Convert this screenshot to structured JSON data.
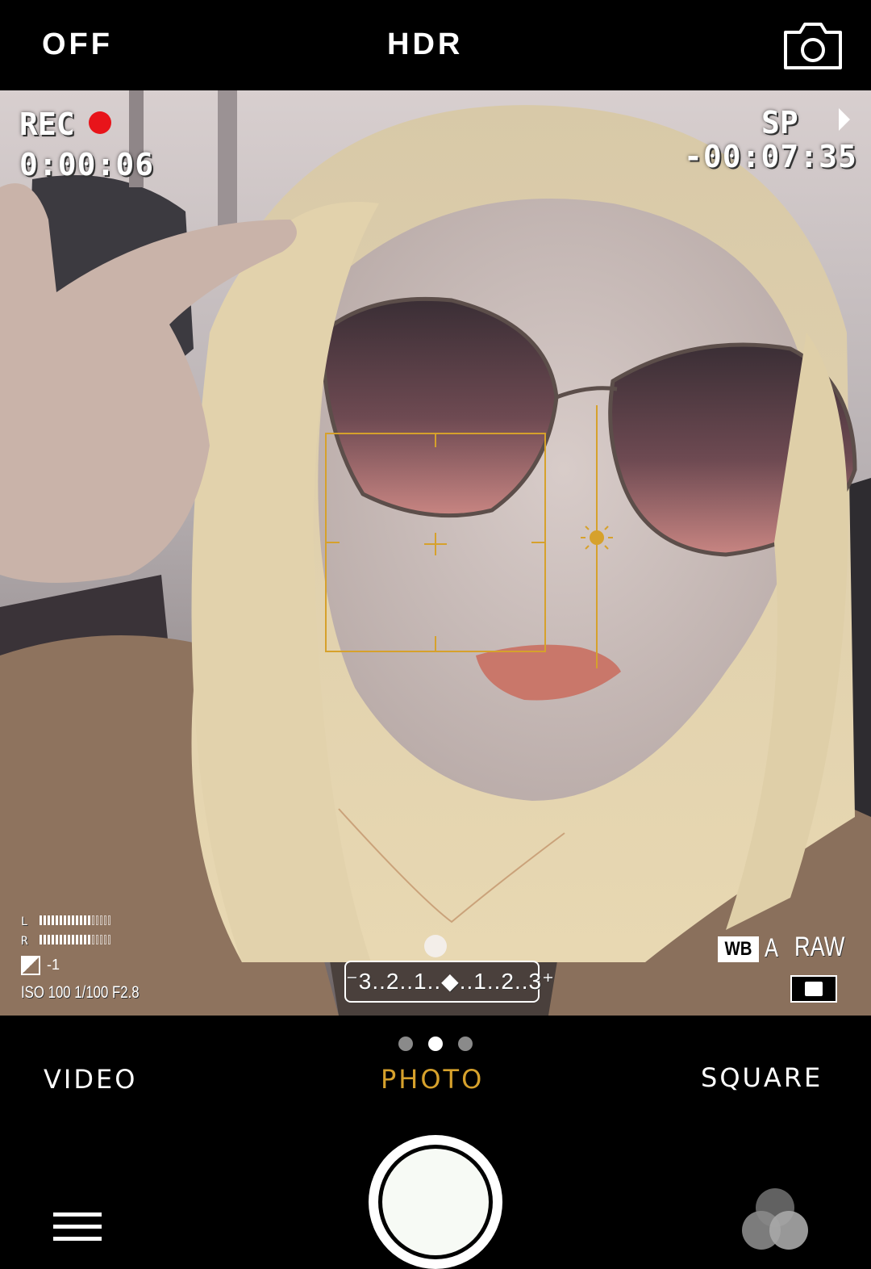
{
  "top_bar": {
    "flash_label": "OFF",
    "hdr_label": "HDR",
    "flip_camera_icon": "camera-flip-icon"
  },
  "viewfinder": {
    "rec_label": "REC",
    "rec_indicator_color": "#e8141a",
    "rec_timer": "0:00:06",
    "tape_speed": "SP",
    "remaining_time": "-00:07:35",
    "audio_meter": {
      "left_label": "L",
      "right_label": "R",
      "left_level": 0.72,
      "right_level": 0.72
    },
    "exposure_compensation": "-1",
    "exposure_settings": "ISO 100  1/100  F2.8",
    "ev_scale": "⁻3..2..1..◆..1..2..3⁺",
    "white_balance_badge": "WB",
    "white_balance_mode": "A",
    "raw_label": "RAW",
    "focus_color": "#d6a12c"
  },
  "bottom": {
    "mode_dots": 3,
    "active_dot": 1,
    "modes": {
      "video": "VIDEO",
      "photo": "PHOTO",
      "square": "SQUARE"
    },
    "active_mode_color": "#d6a12c",
    "menu_icon": "hamburger-menu-icon",
    "filter_icon": "filters-icon"
  }
}
